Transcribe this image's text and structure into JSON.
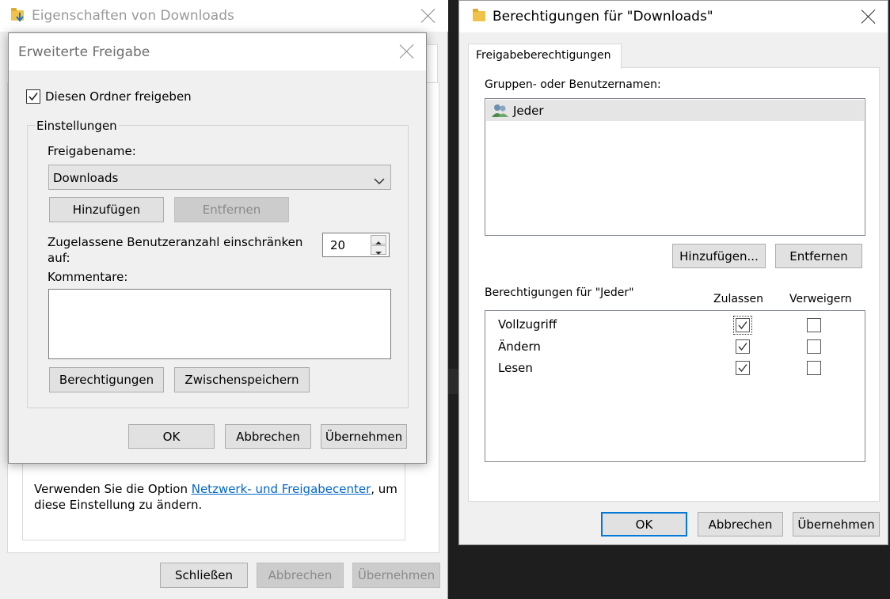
{
  "props_window": {
    "title": "Eigenschaften von Downloads",
    "info_text": "Verwenden Sie die Option",
    "info_link": "Netzwerk- und Freigabecenter",
    "info_suffix": ", um",
    "info_line2": "diese Einstellung zu ändern.",
    "close_label": "Schließen",
    "cancel_label": "Abbrechen",
    "apply_label": "Übernehmen"
  },
  "advanced_share": {
    "title": "Erweiterte Freigabe",
    "share_checkbox_label": "Diesen Ordner freigeben",
    "share_checked": true,
    "settings_group": "Einstellungen",
    "share_name_label": "Freigabename:",
    "share_name_value": "Downloads",
    "add_label": "Hinzufügen",
    "remove_label": "Entfernen",
    "limit_label_line1": "Zugelassene Benutzeranzahl einschränken",
    "limit_label_line2": "auf:",
    "limit_value": "20",
    "comments_label": "Kommentare:",
    "comments_value": "",
    "permissions_label": "Berechtigungen",
    "caching_label": "Zwischenspeichern",
    "ok_label": "OK",
    "cancel_label": "Abbrechen",
    "apply_label": "Übernehmen"
  },
  "permissions_window": {
    "title": "Berechtigungen für \"Downloads\"",
    "tab_label": "Freigabeberechtigungen",
    "groups_label": "Gruppen- oder Benutzernamen:",
    "users": [
      {
        "name": "Jeder",
        "selected": true
      }
    ],
    "add_label": "Hinzufügen...",
    "remove_label": "Entfernen",
    "perm_heading": "Berechtigungen für \"Jeder\"",
    "allow_heading": "Zulassen",
    "deny_heading": "Verweigern",
    "permissions": [
      {
        "name": "Vollzugriff",
        "allow": true,
        "deny": false
      },
      {
        "name": "Ändern",
        "allow": true,
        "deny": false
      },
      {
        "name": "Lesen",
        "allow": true,
        "deny": false
      }
    ],
    "ok_label": "OK",
    "cancel_label": "Abbrechen",
    "apply_label": "Übernehmen"
  },
  "colors": {
    "link": "#0066cc",
    "accent": "#0078d7",
    "window_bg": "#f0f0f0",
    "selection": "#e5e5e5"
  }
}
